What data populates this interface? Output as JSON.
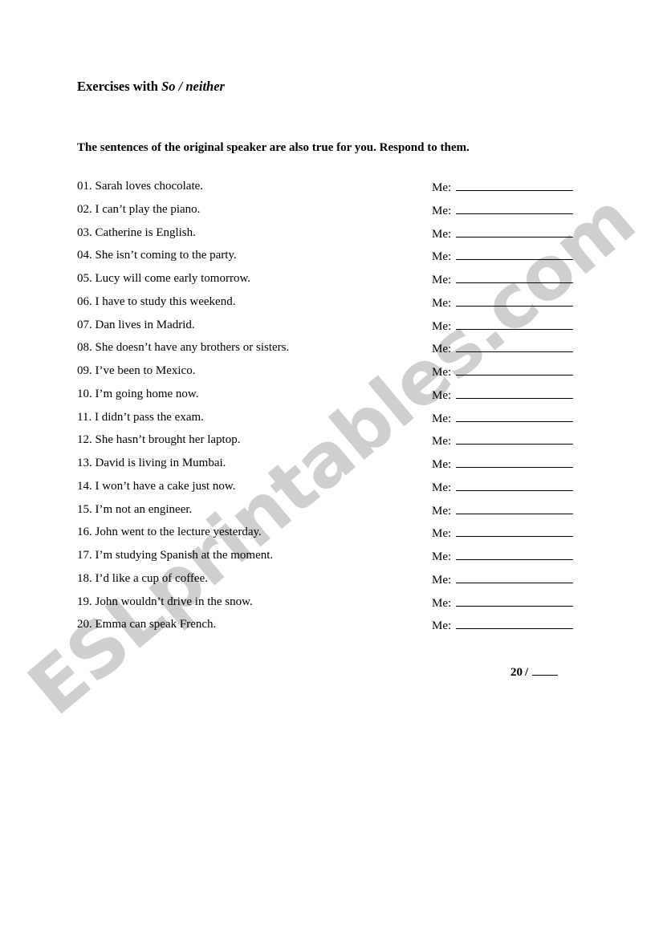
{
  "document": {
    "title_prefix": "Exercises with ",
    "title_emphasis": "So / neither",
    "instructions": "The sentences of the original speaker are also true for you. Respond to them.",
    "answer_label": "Me:",
    "watermark": "ESLprintables.com",
    "watermark_color": "#cfcfcf",
    "page_background": "#ffffff",
    "text_color": "#000000"
  },
  "score": {
    "total": "20",
    "separator": "/",
    "blank": ""
  },
  "exercises": [
    {
      "number": "01.",
      "sentence": "Sarah loves chocolate.",
      "answer": ""
    },
    {
      "number": "02.",
      "sentence": "I can’t play the piano.",
      "answer": ""
    },
    {
      "number": "03.",
      "sentence": "Catherine is English.",
      "answer": ""
    },
    {
      "number": "04.",
      "sentence": "She isn’t coming to the party.",
      "answer": ""
    },
    {
      "number": "05.",
      "sentence": "Lucy will come early tomorrow.",
      "answer": ""
    },
    {
      "number": "06.",
      "sentence": "I have to study this weekend.",
      "answer": ""
    },
    {
      "number": "07.",
      "sentence": "Dan lives in Madrid.",
      "answer": ""
    },
    {
      "number": "08.",
      "sentence": "She doesn’t have any brothers or sisters.",
      "answer": ""
    },
    {
      "number": "09.",
      "sentence": "I’ve been to Mexico.",
      "answer": ""
    },
    {
      "number": "10.",
      "sentence": "I’m going home now.",
      "answer": ""
    },
    {
      "number": "11.",
      "sentence": "I didn’t pass the exam.",
      "answer": ""
    },
    {
      "number": "12.",
      "sentence": "She hasn’t brought her laptop.",
      "answer": ""
    },
    {
      "number": "13.",
      "sentence": "David is living in Mumbai.",
      "answer": ""
    },
    {
      "number": "14.",
      "sentence": "I won’t have a cake just now.",
      "answer": ""
    },
    {
      "number": "15.",
      "sentence": "I’m not an engineer.",
      "answer": ""
    },
    {
      "number": "16.",
      "sentence": "John went to the lecture yesterday.",
      "answer": ""
    },
    {
      "number": "17.",
      "sentence": "I’m studying Spanish at the moment.",
      "answer": ""
    },
    {
      "number": "18.",
      "sentence": "I’d like a cup of coffee.",
      "answer": ""
    },
    {
      "number": "19.",
      "sentence": "John wouldn’t drive in the snow.",
      "answer": ""
    },
    {
      "number": "20.",
      "sentence": "Emma can speak French.",
      "answer": ""
    }
  ]
}
